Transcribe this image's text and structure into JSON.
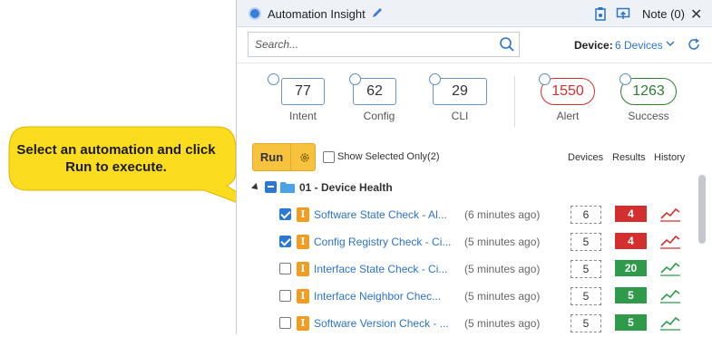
{
  "header": {
    "title": "Automation Insight",
    "note_label": "Note (0)",
    "close_glyph": "✕"
  },
  "search": {
    "placeholder": "Search..."
  },
  "device": {
    "label": "Device:",
    "value": "6 Devices"
  },
  "stats": [
    {
      "value": "77",
      "label": "Intent"
    },
    {
      "value": "62",
      "label": "Config"
    },
    {
      "value": "29",
      "label": "CLI"
    },
    {
      "value": "1550",
      "label": "Alert",
      "color": "#d32f2f"
    },
    {
      "value": "1263",
      "label": "Success",
      "color": "#2e7d32"
    }
  ],
  "toolbar": {
    "run_label": "Run",
    "show_selected_label": "Show Selected Only(2)",
    "col_devices": "Devices",
    "col_results": "Results",
    "col_history": "History"
  },
  "group": {
    "label": "01 - Device Health"
  },
  "rows": [
    {
      "checked": true,
      "badge": "I",
      "name": "Software State Check - Al...",
      "time": "(6 minutes ago)",
      "devices": "6",
      "result": "4",
      "status": "alert"
    },
    {
      "checked": true,
      "badge": "I",
      "name": "Config Registry Check - Ci...",
      "time": "(5 minutes ago)",
      "devices": "5",
      "result": "4",
      "status": "alert"
    },
    {
      "checked": false,
      "badge": "I",
      "name": "Interface State Check - Ci...",
      "time": "(5 minutes ago)",
      "devices": "5",
      "result": "20",
      "status": "success"
    },
    {
      "checked": false,
      "badge": "I",
      "name": "Interface Neighbor Chec...",
      "time": "(5 minutes ago)",
      "devices": "5",
      "result": "5",
      "status": "success"
    },
    {
      "checked": false,
      "badge": "I",
      "name": "Software Version Check - ...",
      "time": "(5 minutes ago)",
      "devices": "5",
      "result": "5",
      "status": "success"
    }
  ],
  "colors": {
    "alert": "#d32f2f",
    "success": "#2e9a4a",
    "accent": "#2c74c9",
    "run": "#f7c23d",
    "callout": "#fbdc1e"
  },
  "callout": {
    "text": "Select an automation and click Run to execute."
  }
}
